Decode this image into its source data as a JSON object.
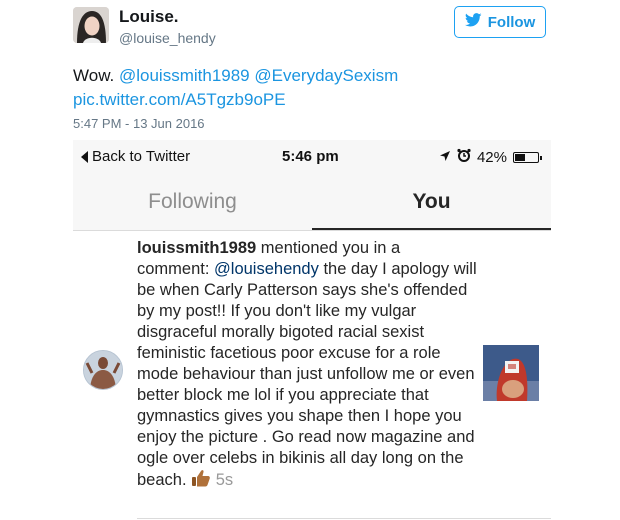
{
  "tweet": {
    "author_name": "Louise.",
    "author_handle": "@louise_hendy",
    "follow_label": "Follow",
    "text_prefix": "Wow. ",
    "mention_1": "@louissmith1989",
    "mention_2": "@EverydaySexism",
    "link": "pic.twitter.com/A5Tgzb9oPE",
    "timestamp": "5:47 PM - 13 Jun 2016",
    "colors": {
      "link": "#1b95e0",
      "follow_border": "#1da1f2"
    }
  },
  "phone": {
    "status_bar": {
      "back_label": "Back to Twitter",
      "time": "5:46 pm",
      "battery_text": "42%",
      "battery_level": 0.42,
      "icons": [
        "location-arrow-icon",
        "alarm-icon",
        "battery-icon"
      ]
    },
    "tabs": [
      {
        "label": "Following",
        "selected": false
      },
      {
        "label": "You",
        "selected": true
      }
    ],
    "notification": {
      "username": "louissmith1989",
      "action": " mentioned you in a comment: ",
      "mention": "@louisehendy",
      "body": " the day I apology will be when Carly Patterson says she's offended by my post!! If you don't like my vulgar disgraceful morally bigoted racial sexist feministic facetious poor excuse for a role mode behaviour than just unfollow me or even better block me lol if you appreciate that gymnastics gives you shape then I hope you enjoy the picture . Go read now magazine and ogle over celebs in bikinis all day long on the beach. ",
      "emoji_icon": "thumbs-up-icon",
      "time": "5s"
    }
  }
}
